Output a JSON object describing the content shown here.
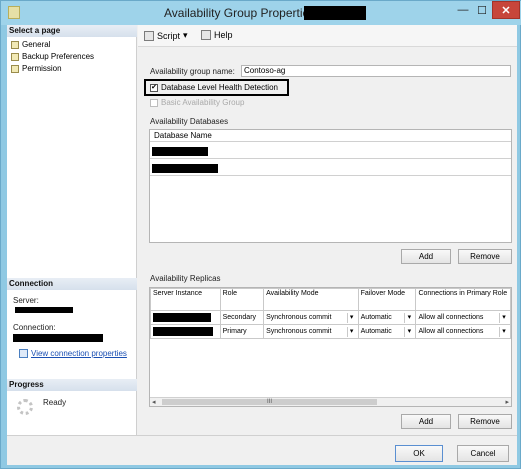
{
  "window": {
    "title": "Availability Group Properties",
    "minimize_glyph": "—",
    "maximize_glyph": "☐",
    "close_glyph": "✕"
  },
  "left": {
    "select_page_heading": "Select a page",
    "pages": [
      {
        "label": "General"
      },
      {
        "label": "Backup Preferences"
      },
      {
        "label": "Permission"
      }
    ],
    "connection_heading": "Connection",
    "server_label": "Server:",
    "connection_label": "Connection:",
    "view_connection_link": "View connection properties",
    "progress_heading": "Progress",
    "progress_status": "Ready"
  },
  "toolbar": {
    "script_label": "Script",
    "help_label": "Help"
  },
  "general": {
    "ag_name_label": "Availability group name:",
    "ag_name_value": "Contoso-ag",
    "db_health_label": "Database Level Health Detection",
    "db_health_checked": true,
    "basic_ag_label": "Basic Availability Group",
    "basic_ag_checked": false
  },
  "availability_databases": {
    "title": "Availability Databases",
    "column_header": "Database Name",
    "add_label": "Add",
    "remove_label": "Remove"
  },
  "availability_replicas": {
    "title": "Availability Replicas",
    "columns": [
      "Server Instance",
      "Role",
      "Availability Mode",
      "Failover Mode",
      "Connections in Primary Role"
    ],
    "rows": [
      {
        "role": "Secondary",
        "mode": "Synchronous commit",
        "failover": "Automatic",
        "connections": "Allow all connections"
      },
      {
        "role": "Primary",
        "mode": "Synchronous commit",
        "failover": "Automatic",
        "connections": "Allow all connections"
      }
    ],
    "scroll_thumb_text": "III",
    "add_label": "Add",
    "remove_label": "Remove"
  },
  "footer": {
    "ok_label": "OK",
    "cancel_label": "Cancel"
  },
  "icons": {
    "check": "✔",
    "dropdown_arrow": "▾",
    "scroll_left": "◂",
    "scroll_right": "▸"
  }
}
